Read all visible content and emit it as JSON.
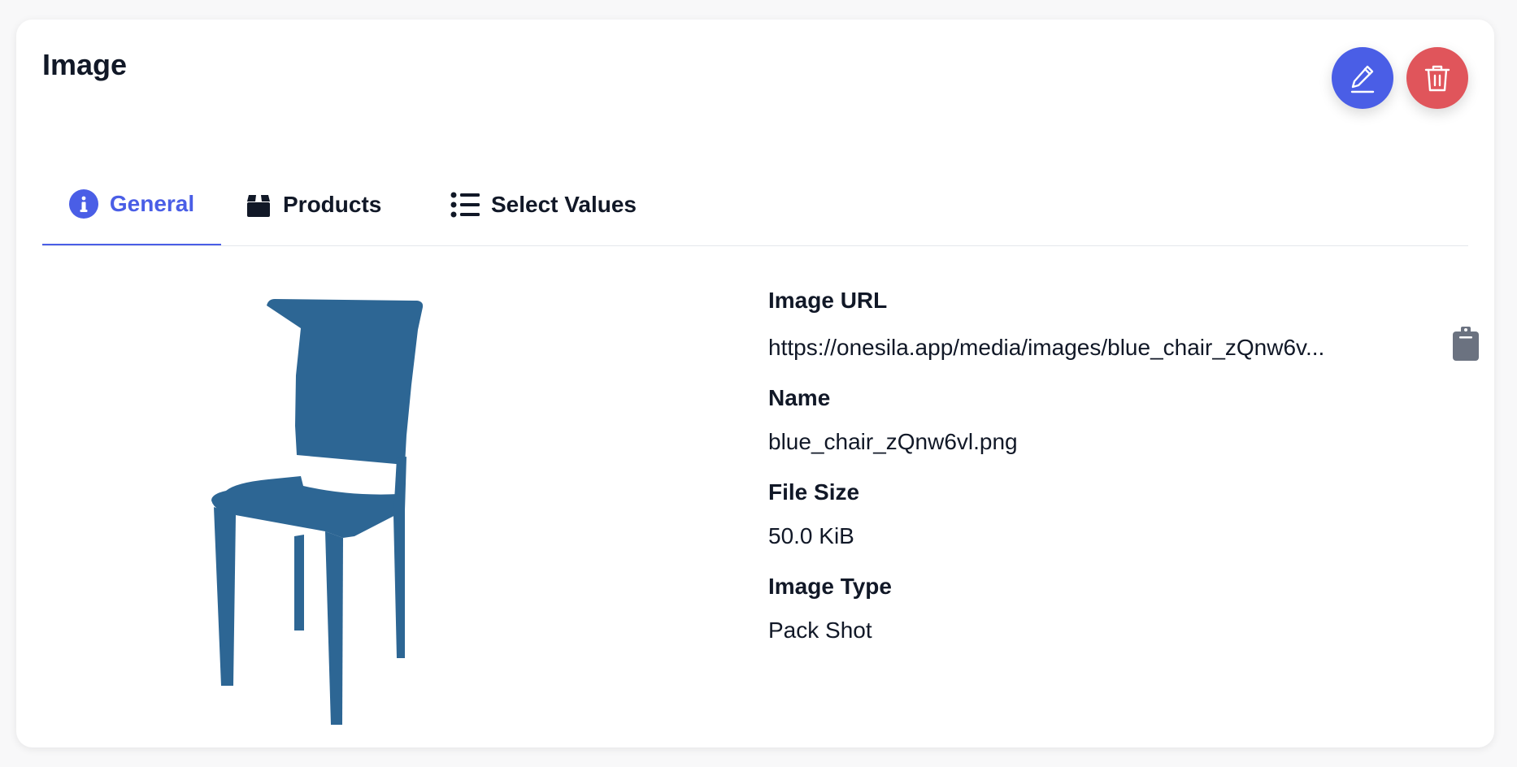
{
  "header": {
    "title": "Image"
  },
  "actions": {
    "edit_icon": "pencil-icon",
    "delete_icon": "trash-icon"
  },
  "tabs": [
    {
      "label": "General",
      "icon": "info-circle-icon",
      "active": true
    },
    {
      "label": "Products",
      "icon": "box-icon",
      "active": false
    },
    {
      "label": "Select Values",
      "icon": "list-icon",
      "active": false
    }
  ],
  "preview": {
    "icon": "chair-image"
  },
  "fields": {
    "image_url": {
      "label": "Image URL",
      "value": "https://onesila.app/media/images/blue_chair_zQnw6v...",
      "copy_icon": "clipboard-icon"
    },
    "name": {
      "label": "Name",
      "value": "blue_chair_zQnw6vl.png"
    },
    "file_size": {
      "label": "File Size",
      "value": "50.0 KiB"
    },
    "image_type": {
      "label": "Image Type",
      "value": "Pack Shot"
    }
  },
  "colors": {
    "accent": "#4a5ee6",
    "danger": "#e0555b",
    "chair": "#2d6694",
    "text": "#111827"
  }
}
